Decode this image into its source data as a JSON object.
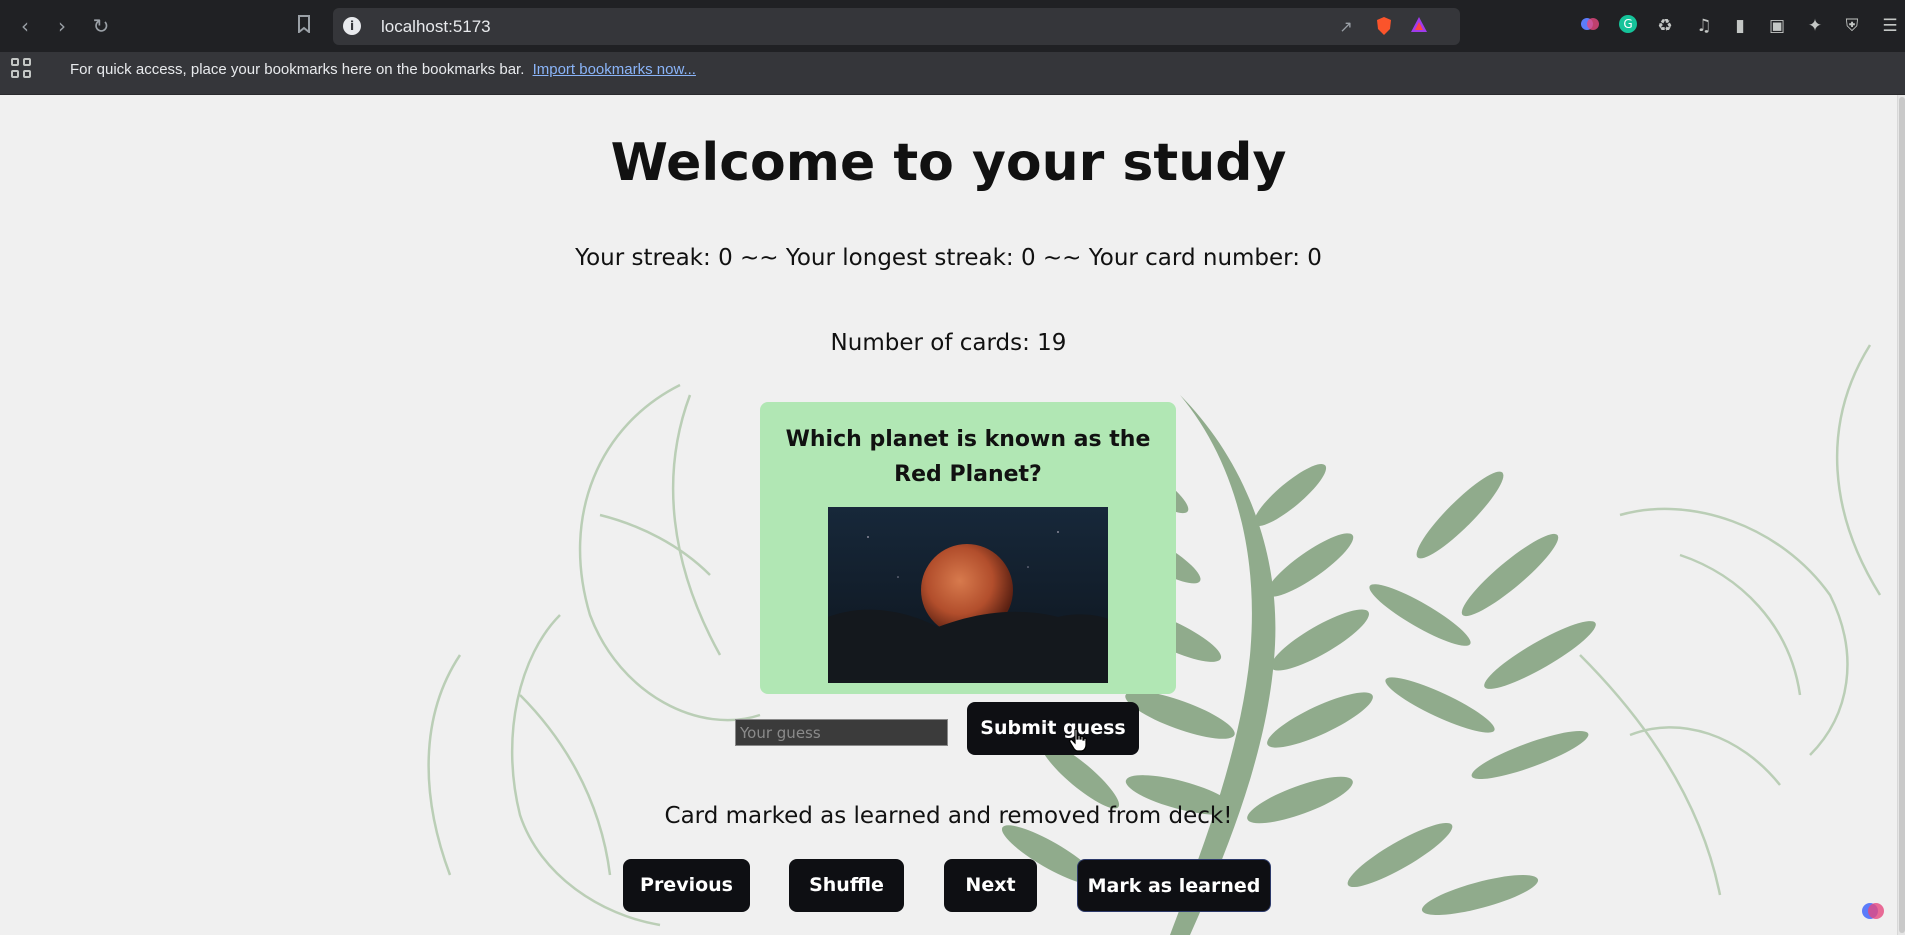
{
  "browser": {
    "url": "localhost:5173",
    "bookmarks_message": "For quick access, place your bookmarks here on the bookmarks bar.",
    "import_link": "Import bookmarks now..."
  },
  "page": {
    "title": "Welcome to your study",
    "stats_line": "Your streak: 0 ~~ Your longest streak: 0 ~~ Your card number: 0",
    "card_count": "Number of cards: 19",
    "card": {
      "question": "Which planet is known as the Red Planet?",
      "image_subject": "planet-mars-image"
    },
    "guess": {
      "value": "",
      "placeholder": "Your guess",
      "submit_label": "Submit guess"
    },
    "message": "Card marked as learned and removed from deck!",
    "controls": {
      "previous": "Previous",
      "shuffle": "Shuffle",
      "next": "Next",
      "mark_learned": "Mark as learned"
    }
  },
  "colors": {
    "card_background": "#b1e7b4",
    "button_background": "#0e0f13",
    "page_background": "#f0f0f0",
    "leaf_green": "#7f9f7a"
  }
}
